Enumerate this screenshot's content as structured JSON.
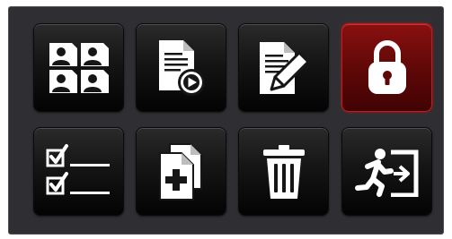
{
  "menu": {
    "tiles": [
      {
        "icon": "contacts-grid-icon",
        "active": false
      },
      {
        "icon": "document-play-icon",
        "active": false
      },
      {
        "icon": "document-edit-icon",
        "active": false
      },
      {
        "icon": "padlock-icon",
        "active": true
      },
      {
        "icon": "checklist-icon",
        "active": false
      },
      {
        "icon": "add-document-icon",
        "active": false
      },
      {
        "icon": "trash-icon",
        "active": false
      },
      {
        "icon": "exit-icon",
        "active": false
      }
    ]
  },
  "colors": {
    "panel_background": "#2f2f33",
    "tile_background": "#151515",
    "active_tile": "#8a1010",
    "active_border": "#c81a1a",
    "icon": "#ffffff"
  }
}
